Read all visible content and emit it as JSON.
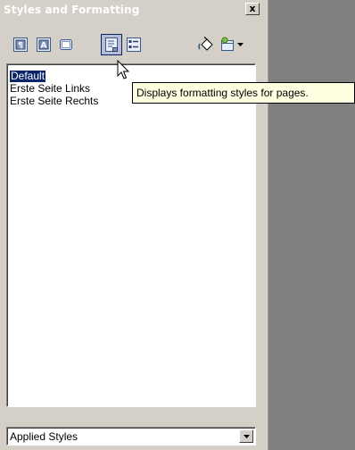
{
  "window": {
    "title": "Styles and Formatting",
    "close_label": "x"
  },
  "toolbar": {
    "buttons": [
      {
        "name": "paragraph-styles",
        "icon": "paragraph-styles-icon"
      },
      {
        "name": "character-styles",
        "icon": "character-styles-icon"
      },
      {
        "name": "frame-styles",
        "icon": "frame-styles-icon"
      },
      {
        "name": "page-styles",
        "icon": "page-styles-icon",
        "active": true
      },
      {
        "name": "list-styles",
        "icon": "list-styles-icon"
      },
      {
        "name": "fill-format-mode",
        "icon": "paint-bucket-icon"
      },
      {
        "name": "new-style-from-selection",
        "icon": "new-style-icon"
      }
    ]
  },
  "styles_list": {
    "items": [
      "Default",
      "Erste Seite Links",
      "Erste Seite Rechts"
    ],
    "selected": "Default"
  },
  "tooltip": {
    "text": "Displays formatting styles for pages."
  },
  "filter": {
    "value": "Applied Styles"
  },
  "colors": {
    "selection": "#0a246a",
    "tooltip_bg": "#ffffe1",
    "panel_bg": "#d4d0c8",
    "workspace": "#808080"
  }
}
